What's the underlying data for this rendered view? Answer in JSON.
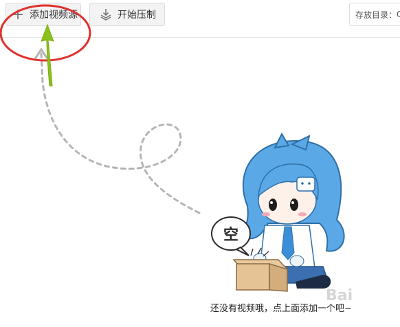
{
  "toolbar": {
    "add_label": "添加视频源",
    "compress_label": "开始压制",
    "save_dir_label": "存放目录：",
    "save_dir_value": "C"
  },
  "empty_state": {
    "bubble_text": "空",
    "message": "还没有视频哦，点上面添加一个吧~"
  },
  "watermark": {
    "text": "Bai"
  },
  "annotation": {
    "highlight_color": "#e0302c",
    "arrow_color": "#8cc11a"
  },
  "icons": {
    "add": "plus-icon",
    "compress": "layers-download-icon"
  }
}
